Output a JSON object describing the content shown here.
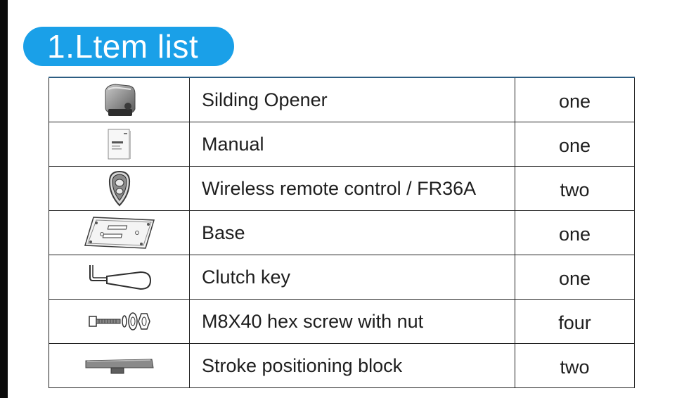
{
  "section": {
    "title": "1.Ltem list"
  },
  "items": [
    {
      "icon": "sliding-gate-motor-icon",
      "name": "Silding Opener",
      "qty": "one"
    },
    {
      "icon": "manual-booklet-icon",
      "name": "Manual",
      "qty": "one"
    },
    {
      "icon": "remote-control-icon",
      "name": "Wireless remote control / FR36A",
      "qty": "two"
    },
    {
      "icon": "base-plate-icon",
      "name": "Base",
      "qty": "one"
    },
    {
      "icon": "clutch-key-icon",
      "name": "Clutch key",
      "qty": "one"
    },
    {
      "icon": "hex-screw-nut-icon",
      "name": "M8X40 hex screw with nut",
      "qty": "four"
    },
    {
      "icon": "positioning-block-icon",
      "name": "Stroke positioning block",
      "qty": "two"
    }
  ],
  "colors": {
    "title_pill": "#1aa0e8",
    "table_top_border": "#2c5d82",
    "left_strip": "#0b0b0b"
  }
}
